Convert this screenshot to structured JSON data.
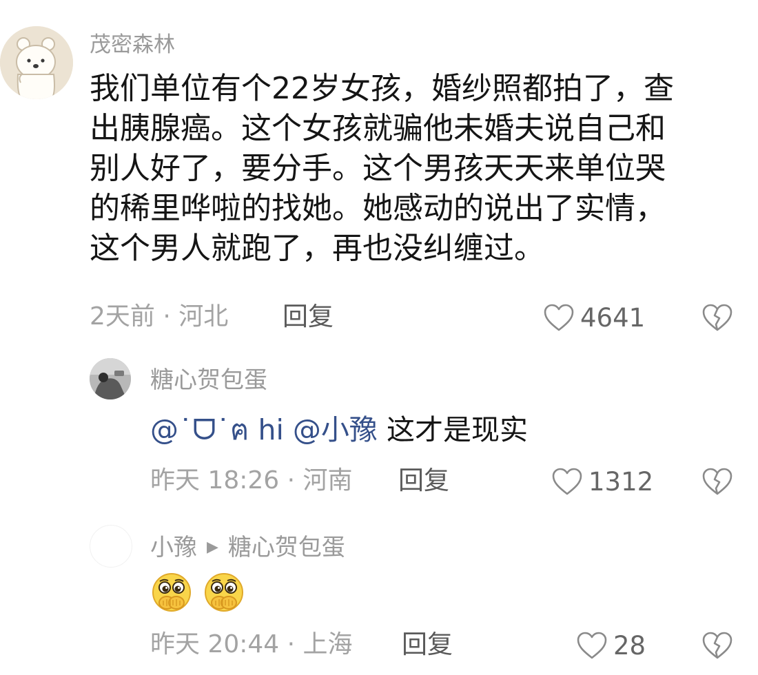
{
  "comments": [
    {
      "username": "茂密森林",
      "body": "我们单位有个22岁女孩，婚纱照都拍了，查\n出胰腺癌。这个女孩就骗他未婚夫说自己和\n别人好了，要分手。这个男孩天天来单位哭\n的稀里哗啦的找她。她感动的说出了实情，\n这个男人就跑了，再也没纠缠过。",
      "time_location": "2天前 · 河北",
      "reply_label": "回复",
      "likes": "4641"
    },
    {
      "username": "糖心贺包蛋",
      "mention1": "@˙ᗜ˙ฅ hi",
      "mention2": "@小豫",
      "text": "这才是现实",
      "time_location": "昨天 18:26 · 河南",
      "reply_label": "回复",
      "likes": "1312"
    },
    {
      "username": "小豫",
      "reply_to": "糖心贺包蛋",
      "emojis": [
        "hands-over-mouth-emoji",
        "hands-over-mouth-emoji"
      ],
      "time_location": "昨天 20:44 · 上海",
      "reply_label": "回复",
      "likes": "28"
    }
  ],
  "icons": {
    "like": "heart-outline-icon",
    "dislike": "broken-heart-icon",
    "reply_arrow": "triangle-right-icon"
  },
  "colors": {
    "meta": "#a3a3a3",
    "mention": "#35508a",
    "body": "#151515"
  }
}
